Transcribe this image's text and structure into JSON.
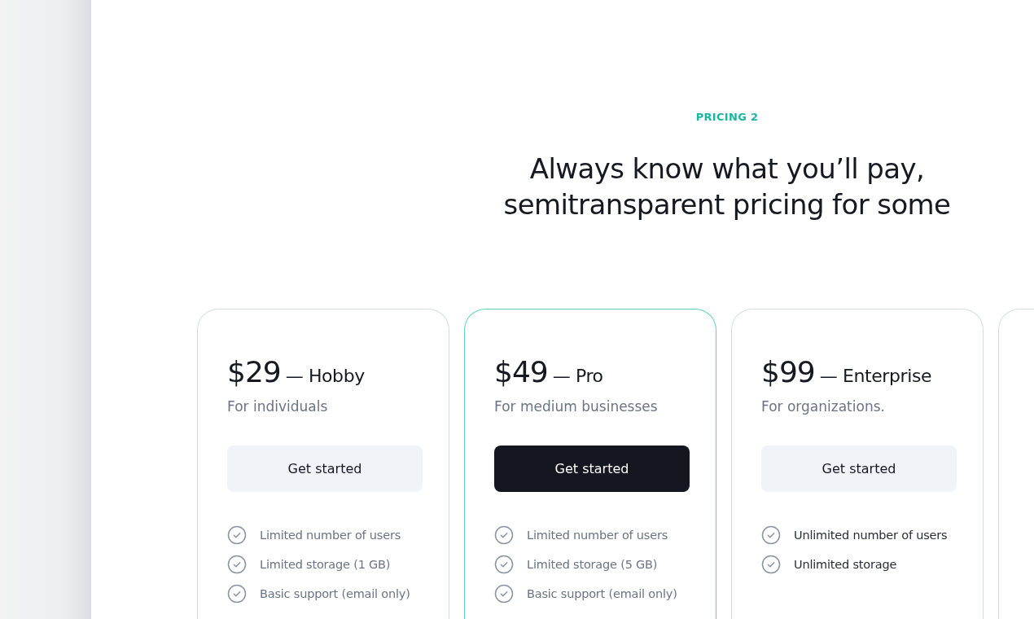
{
  "eyebrow": "PRICING 2",
  "heading": [
    "Always know what you’ll pay,",
    "semitransparent pricing for some"
  ],
  "plans": [
    {
      "kind": "plan",
      "price": "$29",
      "name": "— Hobby",
      "subtitle": "For individuals",
      "button": "Get started",
      "highlighted": false,
      "features": [
        "Limited number of users",
        "Limited storage (1 GB)",
        "Basic support (email only)"
      ]
    },
    {
      "kind": "plan",
      "price": "$49",
      "name": "— Pro",
      "subtitle": "For medium businesses",
      "button": "Get started",
      "highlighted": true,
      "features": [
        "Limited number of users",
        "Limited storage (5 GB)",
        "Basic support (email only)"
      ]
    },
    {
      "kind": "plan",
      "price": "$99",
      "name": "— Enterprise",
      "subtitle": "For organizations.",
      "button": "Get started",
      "highlighted": false,
      "features": [
        "Unlimited number of users",
        "Unlimited storage"
      ]
    },
    {
      "kind": "cut_off"
    }
  ]
}
